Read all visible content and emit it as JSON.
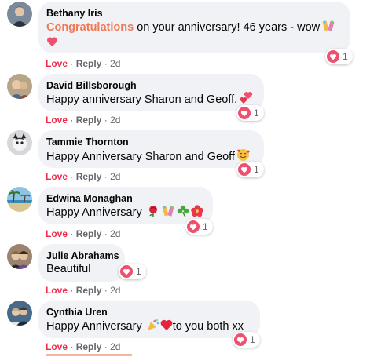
{
  "comments": [
    {
      "author": "Bethany Iris",
      "text_highlight": "Congratulations",
      "text": " on your anniversary! 46 years - wow",
      "reaction_count": "1",
      "love_label": "Love",
      "reply_label": "Reply",
      "separator": "·",
      "time": "2d"
    },
    {
      "author": "David Billsborough",
      "text": "Happy anniversary Sharon and Geoff.",
      "reaction_count": "1",
      "love_label": "Love",
      "reply_label": "Reply",
      "separator": "·",
      "time": "2d"
    },
    {
      "author": "Tammie Thornton",
      "text": "Happy Anniversary Sharon and Geoff",
      "reaction_count": "1",
      "love_label": "Love",
      "reply_label": "Reply",
      "separator": "·",
      "time": "2d"
    },
    {
      "author": "Edwina Monaghan",
      "text": "Happy Anniversary",
      "reaction_count": "1",
      "love_label": "Love",
      "reply_label": "Reply",
      "separator": "·",
      "time": "2d"
    },
    {
      "author": "Julie Abrahams",
      "text": "Beautiful",
      "reaction_count": "1",
      "love_label": "Love",
      "reply_label": "Reply",
      "separator": "·",
      "time": "2d"
    },
    {
      "author": "Cynthia Uren",
      "text": "Happy Anniversary",
      "text_after": "to you both xx",
      "reaction_count": "1",
      "love_label": "Love",
      "reply_label": "Reply",
      "separator": "·",
      "time": "2d"
    }
  ],
  "colors": {
    "bubble": "#f0f2f5",
    "love": "#f02849",
    "highlight": "#f07855",
    "reaction_heart": "#f0506e"
  }
}
